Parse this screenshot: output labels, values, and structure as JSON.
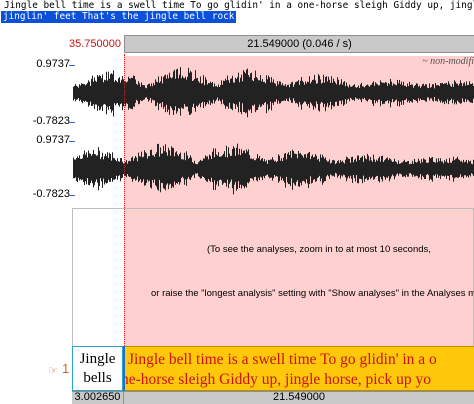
{
  "text_panel": {
    "line1": "Jingle bell time is a swell time To go glidin' in a one-horse sleigh Giddy up, jingl",
    "line2_selected": "jinglin' feet That's the jingle bell rock"
  },
  "editor": {
    "left_time": "35.750000",
    "selection_label": "21.549000 (0.046 / s)",
    "status_label": "~ non-modifi",
    "channel1": {
      "max": "0.9737",
      "min": "-0.7823"
    },
    "channel2": {
      "max": "0.9737",
      "min": "-0.7823"
    },
    "analysis_message_line1": "(To see the analyses, zoom in to at most 10 seconds,",
    "analysis_message_line2": "or raise the \"longest analysis\" setting with \"Show analyses\" in the Analyses menu",
    "menu_glyph": "≡",
    "tier": {
      "number": "1",
      "arrow": "☞",
      "left_interval_text": "Jingle bells",
      "selected_interval_line1": "Jingle bell time is a swell time To go glidin' in a o",
      "selected_interval_line2": "ne-horse sleigh Giddy up, jingle horse, pick up yo"
    },
    "bottom_left_time": "3.002650",
    "bottom_mid_time": "21.549000"
  },
  "colors": {
    "selection_fill": "#ffd0d0",
    "interval_selected": "#ffc80a",
    "text_selection": "#0a50d8",
    "time_red": "#cc1111"
  }
}
